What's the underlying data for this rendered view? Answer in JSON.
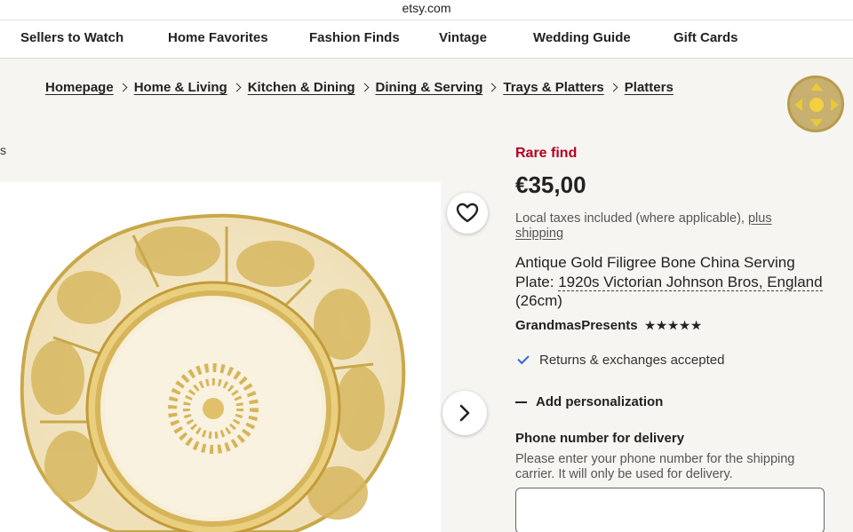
{
  "browser": {
    "url": "etsy.com"
  },
  "nav": {
    "items": [
      "Sellers to Watch",
      "Home Favorites",
      "Fashion Finds",
      "Vintage",
      "Wedding Guide",
      "Gift Cards"
    ]
  },
  "breadcrumb": [
    "Homepage",
    "Home & Living",
    "Kitchen & Dining",
    "Dining & Serving",
    "Trays & Platters",
    "Platters"
  ],
  "gallery": {
    "edge_text": "s",
    "favorite_icon": "heart-icon",
    "next_icon": "chevron-right-icon"
  },
  "product": {
    "badge": "Rare find",
    "price": "€35,00",
    "tax_text": "Local taxes included (where applicable), ",
    "shipping_link": "plus shipping",
    "title_part1": "Antique Gold Filigree Bone China Serving Plate: ",
    "title_part2": "1920s Victorian Johnson Bros, England",
    "title_part3": " (26cm)",
    "shop_name": "GrandmasPresents",
    "rating": 5,
    "returns": "Returns & exchanges accepted",
    "personalization": "Add personalization"
  },
  "phone": {
    "label": "Phone number for delivery",
    "help": "Please enter your phone number for the shipping carrier. It will only be used for delivery.",
    "value": ""
  },
  "colors": {
    "rare": "#b3001f",
    "check": "#2a6ad8",
    "gold": "#c9a84a",
    "plate_cream": "#f6ecd2"
  }
}
